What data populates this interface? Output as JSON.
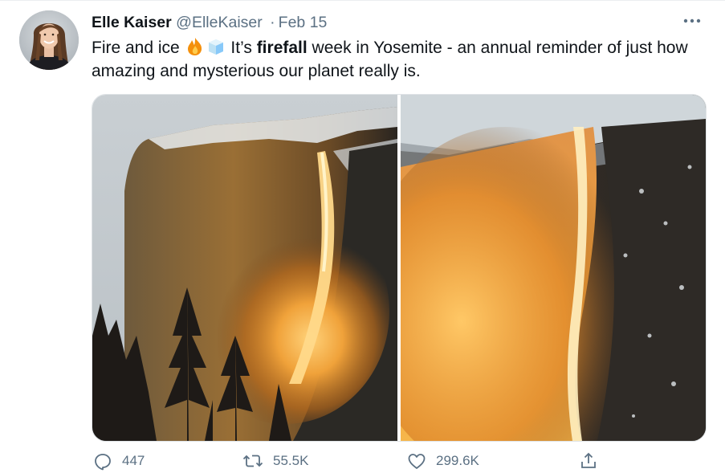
{
  "tweet": {
    "author_name": "Elle Kaiser",
    "author_handle": "@ElleKaiser",
    "separator": "·",
    "date": "Feb 15",
    "text_before": "Fire and ice ",
    "emojis": [
      "fire-emoji",
      "ice-cube-emoji"
    ],
    "text_middle": " It’s ",
    "text_bold": "firefall",
    "text_after": " week in Yosemite - an annual reminder of just how amazing and mysterious our planet really is."
  },
  "media": {
    "photos": [
      "yosemite-firefall-wide-photo",
      "yosemite-firefall-closeup-photo"
    ]
  },
  "actions": {
    "reply_count": "447",
    "retweet_count": "55.5K",
    "like_count": "299.6K"
  },
  "icons": {
    "more": "more-horizontal-icon",
    "reply": "reply-icon",
    "retweet": "retweet-icon",
    "like": "heart-icon",
    "share": "share-icon"
  },
  "colors": {
    "text": "#0f1419",
    "secondary": "#5b7083",
    "border": "#dfe3e6",
    "fire": "#ff9a1e"
  }
}
